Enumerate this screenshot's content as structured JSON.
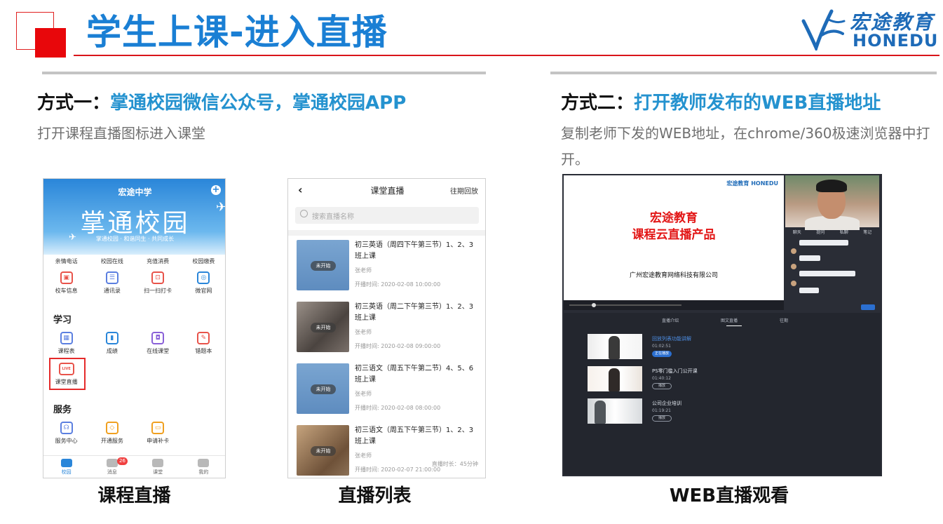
{
  "header": {
    "title": "学生上课-进入直播",
    "logo_cn": "宏途教育",
    "logo_en": "HONEDU"
  },
  "method1": {
    "prefix": "方式一：",
    "text": "掌通校园微信公众号，掌通校园APP",
    "desc": "打开课程直播图标进入课堂"
  },
  "method2": {
    "prefix": "方式二：",
    "text": "打开教师发布的WEB直播地址",
    "desc": "复制老师下发的WEB地址，在chrome/360极速浏览器中打开。"
  },
  "phone1": {
    "school": "宏途中学",
    "brand": "掌通校园",
    "slogan": "掌通校园 · 和谐同生 · 共同成长",
    "quick": [
      "亲情电话",
      "校园在线",
      "充值消费",
      "校园缴费"
    ],
    "row1": [
      {
        "label": "校车信息",
        "icon": "bus-icon",
        "color": "#e8534a",
        "glyph": "▣"
      },
      {
        "label": "通讯录",
        "icon": "contacts-icon",
        "color": "#5b7fe0",
        "glyph": "☰"
      },
      {
        "label": "扫一扫打卡",
        "icon": "scan-icon",
        "color": "#e8534a",
        "glyph": "⊡"
      },
      {
        "label": "微官网",
        "icon": "globe-icon",
        "color": "#2a86d9",
        "glyph": "◎"
      }
    ],
    "section_study": "学习",
    "row2": [
      {
        "label": "课程表",
        "icon": "schedule-icon",
        "color": "#5b7fe0",
        "glyph": "▦"
      },
      {
        "label": "成绩",
        "icon": "grades-icon",
        "color": "#2a86d9",
        "glyph": "▮"
      },
      {
        "label": "在线课堂",
        "icon": "online-class-icon",
        "color": "#8a60d8",
        "glyph": "◘"
      },
      {
        "label": "错题本",
        "icon": "mistakes-icon",
        "color": "#e8534a",
        "glyph": "✎"
      }
    ],
    "row3": [
      {
        "label": "课堂直播",
        "icon": "live-icon",
        "color": "#e8534a",
        "glyph": "LIVE"
      }
    ],
    "section_service": "服务",
    "row4": [
      {
        "label": "服务中心",
        "icon": "service-center-icon",
        "color": "#5b7fe0",
        "glyph": "☊"
      },
      {
        "label": "开通服务",
        "icon": "open-service-icon",
        "color": "#f0a020",
        "glyph": "◇"
      },
      {
        "label": "申请补卡",
        "icon": "card-icon",
        "color": "#f0a020",
        "glyph": "▭"
      }
    ],
    "tabs": [
      "校园",
      "消息",
      "课堂",
      "我的"
    ],
    "badge": "26"
  },
  "phone2": {
    "title": "课堂直播",
    "replay": "往期回放",
    "search_placeholder": "搜索直播名称",
    "thumb_label": "未开始",
    "courses": [
      {
        "title": "初三英语（周四下午第三节）1、2、3班上课",
        "teacher": "张老师",
        "time": "开播时间: 2020-02-08 10:00:00",
        "duration": ""
      },
      {
        "title": "初三英语（周二下午第三节）1、2、3班上课",
        "teacher": "张老师",
        "time": "开播时间: 2020-02-08 09:00:00",
        "duration": ""
      },
      {
        "title": "初三语文（周五下午第二节）4、5、6班上课",
        "teacher": "张老师",
        "time": "开播时间: 2020-02-08 08:00:00",
        "duration": ""
      },
      {
        "title": "初三语文（周五下午第三节）1、2、3班上课",
        "teacher": "张老师",
        "time": "开播时间: 2020-02-07 21:00:00",
        "duration": "直播时长：45分钟"
      }
    ]
  },
  "web": {
    "slide_logo": "宏途教育 HONEDU",
    "slide_title1": "宏途教育",
    "slide_title2": "课程云直播产品",
    "slide_company": "广州宏途教育网络科技有限公司",
    "chat_tabs": [
      "聊天",
      "提问",
      "私聊",
      "笔记"
    ],
    "list_tabs": [
      "直播介绍",
      "图文直播",
      "往期"
    ],
    "videos": [
      {
        "title": "回放列表功能讲解",
        "duration": "01:02:51",
        "button": "正在播放"
      },
      {
        "title": "PS零门槛入门公开课",
        "duration": "01:40:12",
        "button": "播放"
      },
      {
        "title": "公司企业培训",
        "duration": "01:19:21",
        "button": "播放"
      }
    ]
  },
  "captions": {
    "c1": "课程直播",
    "c2": "直播列表",
    "c3": "WEB直播观看"
  }
}
